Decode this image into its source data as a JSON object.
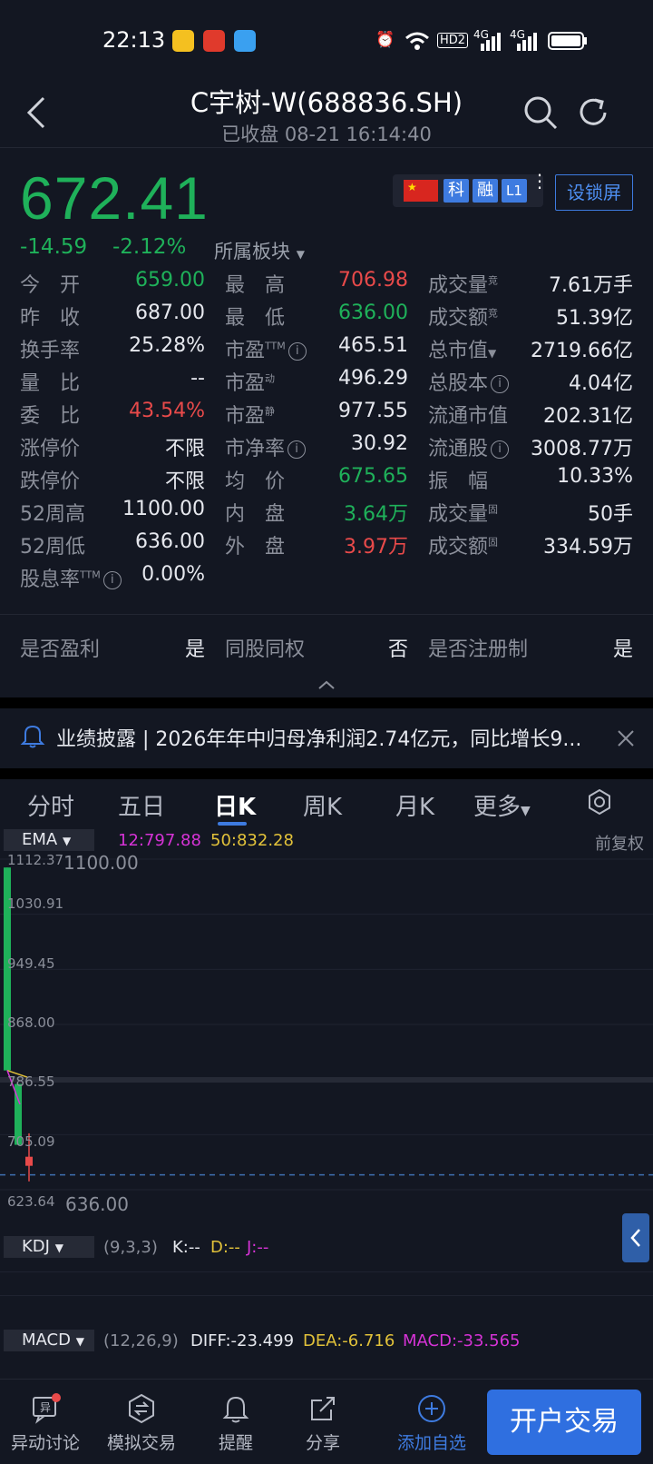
{
  "status_bar": {
    "time": "22:13",
    "network_badge": "HD2",
    "signal_1": "4G",
    "signal_2": "4G"
  },
  "header": {
    "title": "C宇树-W(688836.SH)",
    "subtitle": "已收盘 08-21 16:14:40"
  },
  "quote": {
    "price": "672.41",
    "change": "-14.59",
    "change_pct": "-2.12%",
    "sector_label": "所属板块",
    "badges": [
      "科",
      "融",
      "L1"
    ],
    "lock_label": "设锁屏",
    "rows": [
      [
        {
          "label": "今　开",
          "value": "659.00"
        },
        {
          "label": "最　高",
          "value": "706.98"
        },
        {
          "label": "成交量",
          "value": "7.61万手"
        }
      ],
      [
        {
          "label": "昨　收",
          "value": "687.00"
        },
        {
          "label": "最　低",
          "value": "636.00"
        },
        {
          "label": "成交额",
          "value": "51.39亿"
        }
      ],
      [
        {
          "label": "换手率",
          "value": "25.28%"
        },
        {
          "label": "市盈",
          "value": "465.51"
        },
        {
          "label": "总市值",
          "value": "2719.66亿"
        }
      ],
      [
        {
          "label": "量　比",
          "value": "--"
        },
        {
          "label": "市盈",
          "value": "496.29"
        },
        {
          "label": "总股本",
          "value": "4.04亿"
        }
      ],
      [
        {
          "label": "委　比",
          "value": "43.54%"
        },
        {
          "label": "市盈",
          "value": "977.55"
        },
        {
          "label": "流通市值",
          "value": "202.31亿"
        }
      ],
      [
        {
          "label": "涨停价",
          "value": "不限"
        },
        {
          "label": "市净率",
          "value": "30.92"
        },
        {
          "label": "流通股",
          "value": "3008.77万"
        }
      ],
      [
        {
          "label": "跌停价",
          "value": "不限"
        },
        {
          "label": "均　价",
          "value": "675.65"
        },
        {
          "label": "振　幅",
          "value": "10.33%"
        }
      ],
      [
        {
          "label": "52周高",
          "value": "1100.00"
        },
        {
          "label": "内　盘",
          "value": "3.64万"
        },
        {
          "label": "成交量",
          "value": "50手"
        }
      ],
      [
        {
          "label": "52周低",
          "value": "636.00"
        },
        {
          "label": "外　盘",
          "value": "3.97万"
        },
        {
          "label": "成交额",
          "value": "334.59万"
        }
      ],
      [
        {
          "label": "股息率",
          "value": "0.00%"
        }
      ]
    ],
    "sups": {
      "ttm": "TTM",
      "dong": "动",
      "jing": "静",
      "jing2": "竞",
      "gu": "固"
    },
    "flags": [
      {
        "label": "是否盈利",
        "value": "是"
      },
      {
        "label": "同股同权",
        "value": "否"
      },
      {
        "label": "是否注册制",
        "value": "是"
      }
    ]
  },
  "notice": {
    "text": "业绩披露 | 2026年年中归母净利润2.74亿元，同比增长9..."
  },
  "tabs": [
    "分时",
    "五日",
    "日K",
    "周K",
    "月K",
    "更多"
  ],
  "active_tab": "日K",
  "chart": {
    "indicator": "EMA",
    "ema12": "12:797.88",
    "ema50": "50:832.28",
    "adjust": "前复权",
    "high_label": "1100.00",
    "low_label": "636.00",
    "y_ticks": [
      "1112.37",
      "1030.91",
      "949.45",
      "868.00",
      "786.55",
      "705.09",
      "623.64"
    ],
    "kdj": {
      "name": "KDJ",
      "params": "(9,3,3)",
      "k": "K:--",
      "d": "D:--",
      "j": "J:--"
    },
    "macd": {
      "name": "MACD",
      "params": "(12,26,9)",
      "diff": "DIFF:-23.499",
      "dea": "DEA:-6.716",
      "macd": "MACD:-33.565"
    },
    "colors": {
      "up": "#e84a4a",
      "down": "#1fb15a",
      "ema12": "#d633d6",
      "ema50": "#e2c23a"
    }
  },
  "chart_data": {
    "type": "candlestick",
    "ylim": [
      623.64,
      1112.37
    ],
    "candles": [
      {
        "open": 1100.0,
        "close": 800.0,
        "high": 1100.0,
        "low": 800.0
      },
      {
        "open": 780.0,
        "close": 690.0,
        "high": 780.0,
        "low": 690.0
      },
      {
        "open": 659.0,
        "close": 672.41,
        "high": 706.98,
        "low": 636.0
      }
    ]
  },
  "bottom_nav": [
    "异动讨论",
    "模拟交易",
    "提醒",
    "分享",
    "添加自选"
  ],
  "open_account": "开户交易"
}
